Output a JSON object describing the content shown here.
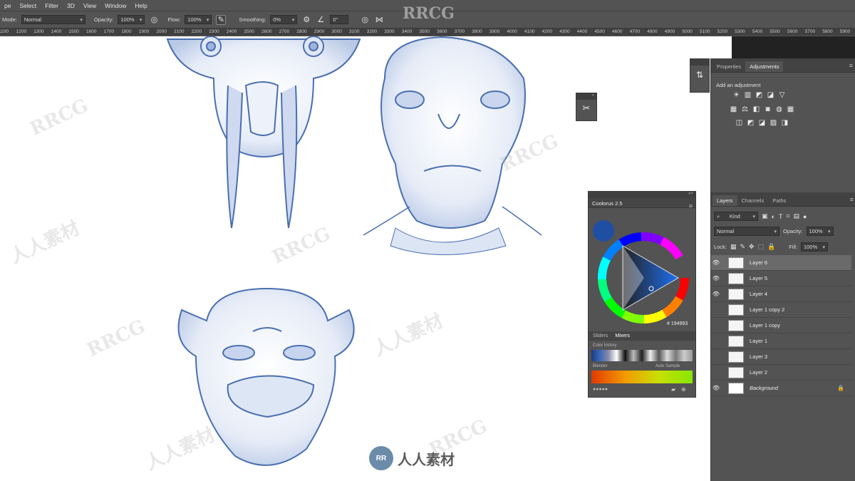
{
  "menu": [
    "pe",
    "Select",
    "Filter",
    "3D",
    "View",
    "Window",
    "Help"
  ],
  "options": {
    "mode_label": "Mode:",
    "mode_value": "Normal",
    "opacity_label": "Opacity:",
    "opacity_value": "100%",
    "flow_label": "Flow:",
    "flow_value": "100%",
    "smoothing_label": "Smoothing:",
    "smoothing_value": "0%",
    "angle_value": "0°"
  },
  "ruler_ticks": [
    "1100",
    "1200",
    "1300",
    "1400",
    "1500",
    "1600",
    "1700",
    "1800",
    "1900",
    "2000",
    "2100",
    "2200",
    "2300",
    "2400",
    "2500",
    "2600",
    "2700",
    "2800",
    "2900",
    "3000",
    "3100",
    "3200",
    "3300",
    "3400",
    "3500",
    "3600",
    "3700",
    "3800",
    "3900",
    "4000",
    "4100",
    "4200",
    "4300",
    "4400",
    "4500",
    "4600",
    "4700",
    "4800",
    "4900",
    "5000",
    "5100",
    "5200",
    "5300",
    "5400",
    "5500",
    "5600",
    "5700",
    "5800",
    "5900",
    "6000"
  ],
  "adjustments": {
    "tabs": [
      "Properties",
      "Adjustments"
    ],
    "active_tab": "Adjustments",
    "title": "Add an adjustment",
    "row1": [
      "☀",
      "▥",
      "◩",
      "◪",
      "▽"
    ],
    "row2": [
      "▦",
      "⚖",
      "◧",
      "◙",
      "◍",
      "▦"
    ],
    "row3": [
      "◫",
      "◩",
      "◪",
      "▨",
      "◨"
    ]
  },
  "layers_panel": {
    "tabs": [
      "Layers",
      "Channels",
      "Paths"
    ],
    "active_tab": "Layers",
    "kind_label": "Kind",
    "blend_value": "Normal",
    "opacity_label": "Opacity:",
    "opacity_value": "100%",
    "lock_label": "Lock:",
    "fill_label": "Fill:",
    "fill_value": "100%",
    "layers": [
      {
        "name": "Layer 6",
        "visible": true,
        "selected": true
      },
      {
        "name": "Layer 5",
        "visible": true,
        "selected": false
      },
      {
        "name": "Layer 4",
        "visible": true,
        "selected": false
      },
      {
        "name": "Layer 1 copy 2",
        "visible": false,
        "selected": false
      },
      {
        "name": "Layer 1 copy",
        "visible": false,
        "selected": false
      },
      {
        "name": "Layer 1",
        "visible": false,
        "selected": false
      },
      {
        "name": "Layer 3",
        "visible": false,
        "selected": false
      },
      {
        "name": "Layer 2",
        "visible": false,
        "selected": false
      },
      {
        "name": "Background",
        "visible": true,
        "selected": false,
        "locked": true
      }
    ]
  },
  "coolorus": {
    "title": "Coolorus 2.5",
    "hex": "194993",
    "hex_prefix": "#",
    "tabs": [
      "Sliders",
      "Mixers"
    ],
    "active_tab": "Mixers",
    "history_label": "Color history",
    "blender_label": "Blender",
    "auto_sample_label": "Auto Sample",
    "current_color": "#1f4fa3"
  },
  "watermark": {
    "text": "RRCG",
    "cn_text": "人人素材",
    "logo_letters": "RR"
  },
  "colors": {
    "sketch": "#4a6fb0",
    "panel": "#535353",
    "selected_layer": "#6a6a6a"
  }
}
